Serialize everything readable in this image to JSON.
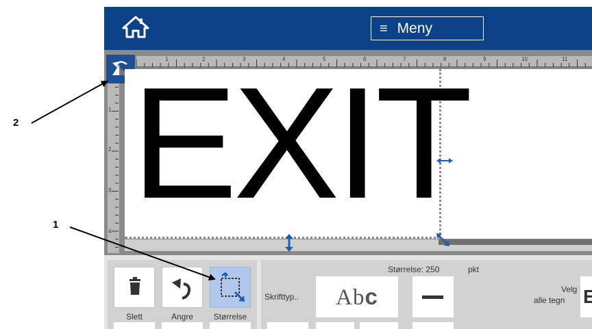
{
  "header": {
    "home_icon": "home-icon",
    "menu_label": "Meny",
    "menu_icon": "hamburger-icon"
  },
  "ruler": {
    "top_marks": [
      "1",
      "2",
      "3",
      "4",
      "5",
      "6",
      "7",
      "8",
      "9",
      "10",
      "11"
    ],
    "left_marks": [
      "1",
      "2",
      "3",
      "4"
    ]
  },
  "canvas": {
    "label_text": "EXIT"
  },
  "callouts": {
    "one": "1",
    "two": "2"
  },
  "toolbar": {
    "delete_label": "Slett",
    "undo_label": "Angre",
    "resize_label": "Størrelse"
  },
  "font_panel": {
    "size_label": "Størrelse: 250",
    "size_unit": "pkt",
    "font_label": "Skrifttyp..",
    "font_sample_a": "Ab",
    "font_sample_c": "c",
    "select_all_line1": "Velg",
    "select_all_line2": "alle tegn",
    "select_all_cut": "E"
  },
  "colors": {
    "header_bg": "#0d4187",
    "selected_tool_bg": "#b2c7ec",
    "handle_blue": "#1b5fb4"
  }
}
